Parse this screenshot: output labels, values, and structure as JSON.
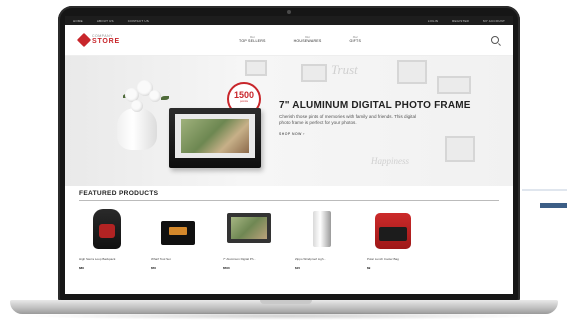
{
  "topbar": {
    "left_links": [
      "Home",
      "About Us",
      "Contact Us"
    ],
    "right_links": [
      "Login",
      "Register",
      "My Account"
    ]
  },
  "header": {
    "logo_top": "COMPANY",
    "logo_bottom": "STORE",
    "nav": [
      {
        "small": "Our",
        "label": "TOP SELLERS"
      },
      {
        "small": "Our",
        "label": "HOUSEWARES"
      },
      {
        "small": "Our",
        "label": "GIFTS"
      }
    ],
    "search_icon": "search-icon"
  },
  "hero": {
    "badge_number": "1500",
    "badge_sub": "points",
    "title": "7\" ALUMINUM DIGITAL PHOTO FRAME",
    "description": "Cherish those pints of memories with family and friends. This digital photo frame is perfect for your photos.",
    "cta": "SHOP NOW ›",
    "wall_words": [
      "Trust",
      "Happiness"
    ]
  },
  "featured": {
    "title": "FEATURED PRODUCTS",
    "products": [
      {
        "name": "High Sierra Loop Backpack",
        "price": "$80",
        "icon": "backpack"
      },
      {
        "name": "Wharf Tool Set",
        "price": "$50",
        "icon": "tool-set"
      },
      {
        "name": "7\" Aluminum Digital Ph...",
        "price": "$500",
        "icon": "photo-frame"
      },
      {
        "name": "Zippo Windproof Ligh...",
        "price": "$15",
        "icon": "lighter"
      },
      {
        "name": "Polar Lunch Cooler Bag",
        "price": "$9",
        "icon": "cooler-bag"
      }
    ]
  },
  "colors": {
    "brand": "#c8262b",
    "topbar": "#1d1d1d",
    "accent_arrow": "#3c5e86"
  }
}
